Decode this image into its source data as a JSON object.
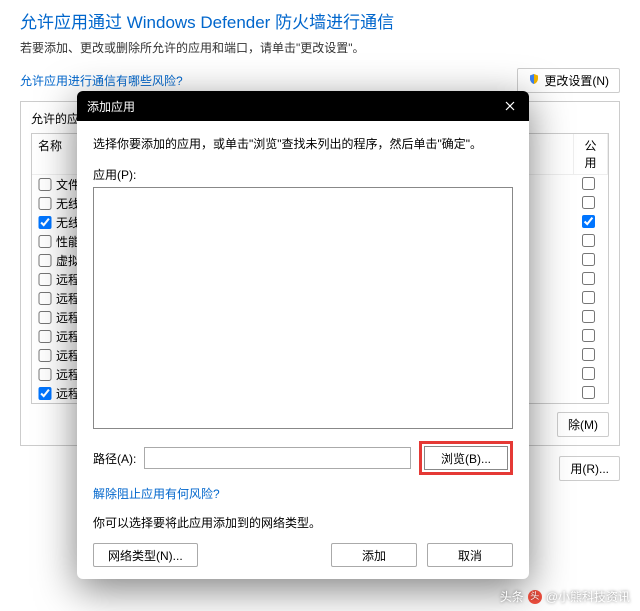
{
  "header": {
    "title": "允许应用通过 Windows Defender 防火墙进行通信",
    "subtitle": "若要添加、更改或删除所允许的应用和端口，请单击\"更改设置\"。",
    "risk_link": "允许应用进行通信有哪些风险?",
    "change_settings_btn": "更改设置(N)"
  },
  "panel": {
    "title": "允许的应",
    "col_name": "名称",
    "col_public": "公用",
    "rows": [
      {
        "checked": false,
        "name": "文件",
        "pub": false
      },
      {
        "checked": false,
        "name": "无线",
        "pub": false
      },
      {
        "checked": true,
        "name": "无线",
        "pub": true
      },
      {
        "checked": false,
        "name": "性能",
        "pub": false
      },
      {
        "checked": false,
        "name": "虚拟",
        "pub": false
      },
      {
        "checked": false,
        "name": "远程",
        "pub": false
      },
      {
        "checked": false,
        "name": "远程",
        "pub": false
      },
      {
        "checked": false,
        "name": "远程",
        "pub": false
      },
      {
        "checked": false,
        "name": "远程",
        "pub": false
      },
      {
        "checked": false,
        "name": "远程",
        "pub": false
      },
      {
        "checked": false,
        "name": "远程",
        "pub": false
      },
      {
        "checked": true,
        "name": "远程",
        "pub": false
      }
    ],
    "remove_btn": "除(M)",
    "allow_other_btn": "用(R)..."
  },
  "modal": {
    "title": "添加应用",
    "instruction": "选择你要添加的应用，或单击\"浏览\"查找未列出的程序，然后单击\"确定\"。",
    "apps_label": "应用(P):",
    "path_label": "路径(A):",
    "path_value": "",
    "browse_btn": "浏览(B)...",
    "risk_link": "解除阻止应用有何风险?",
    "network_text": "你可以选择要将此应用添加到的网络类型。",
    "network_btn": "网络类型(N)...",
    "add_btn": "添加",
    "cancel_btn": "取消"
  },
  "watermark": {
    "prefix": "头条",
    "text": "@小熊科技资讯"
  }
}
